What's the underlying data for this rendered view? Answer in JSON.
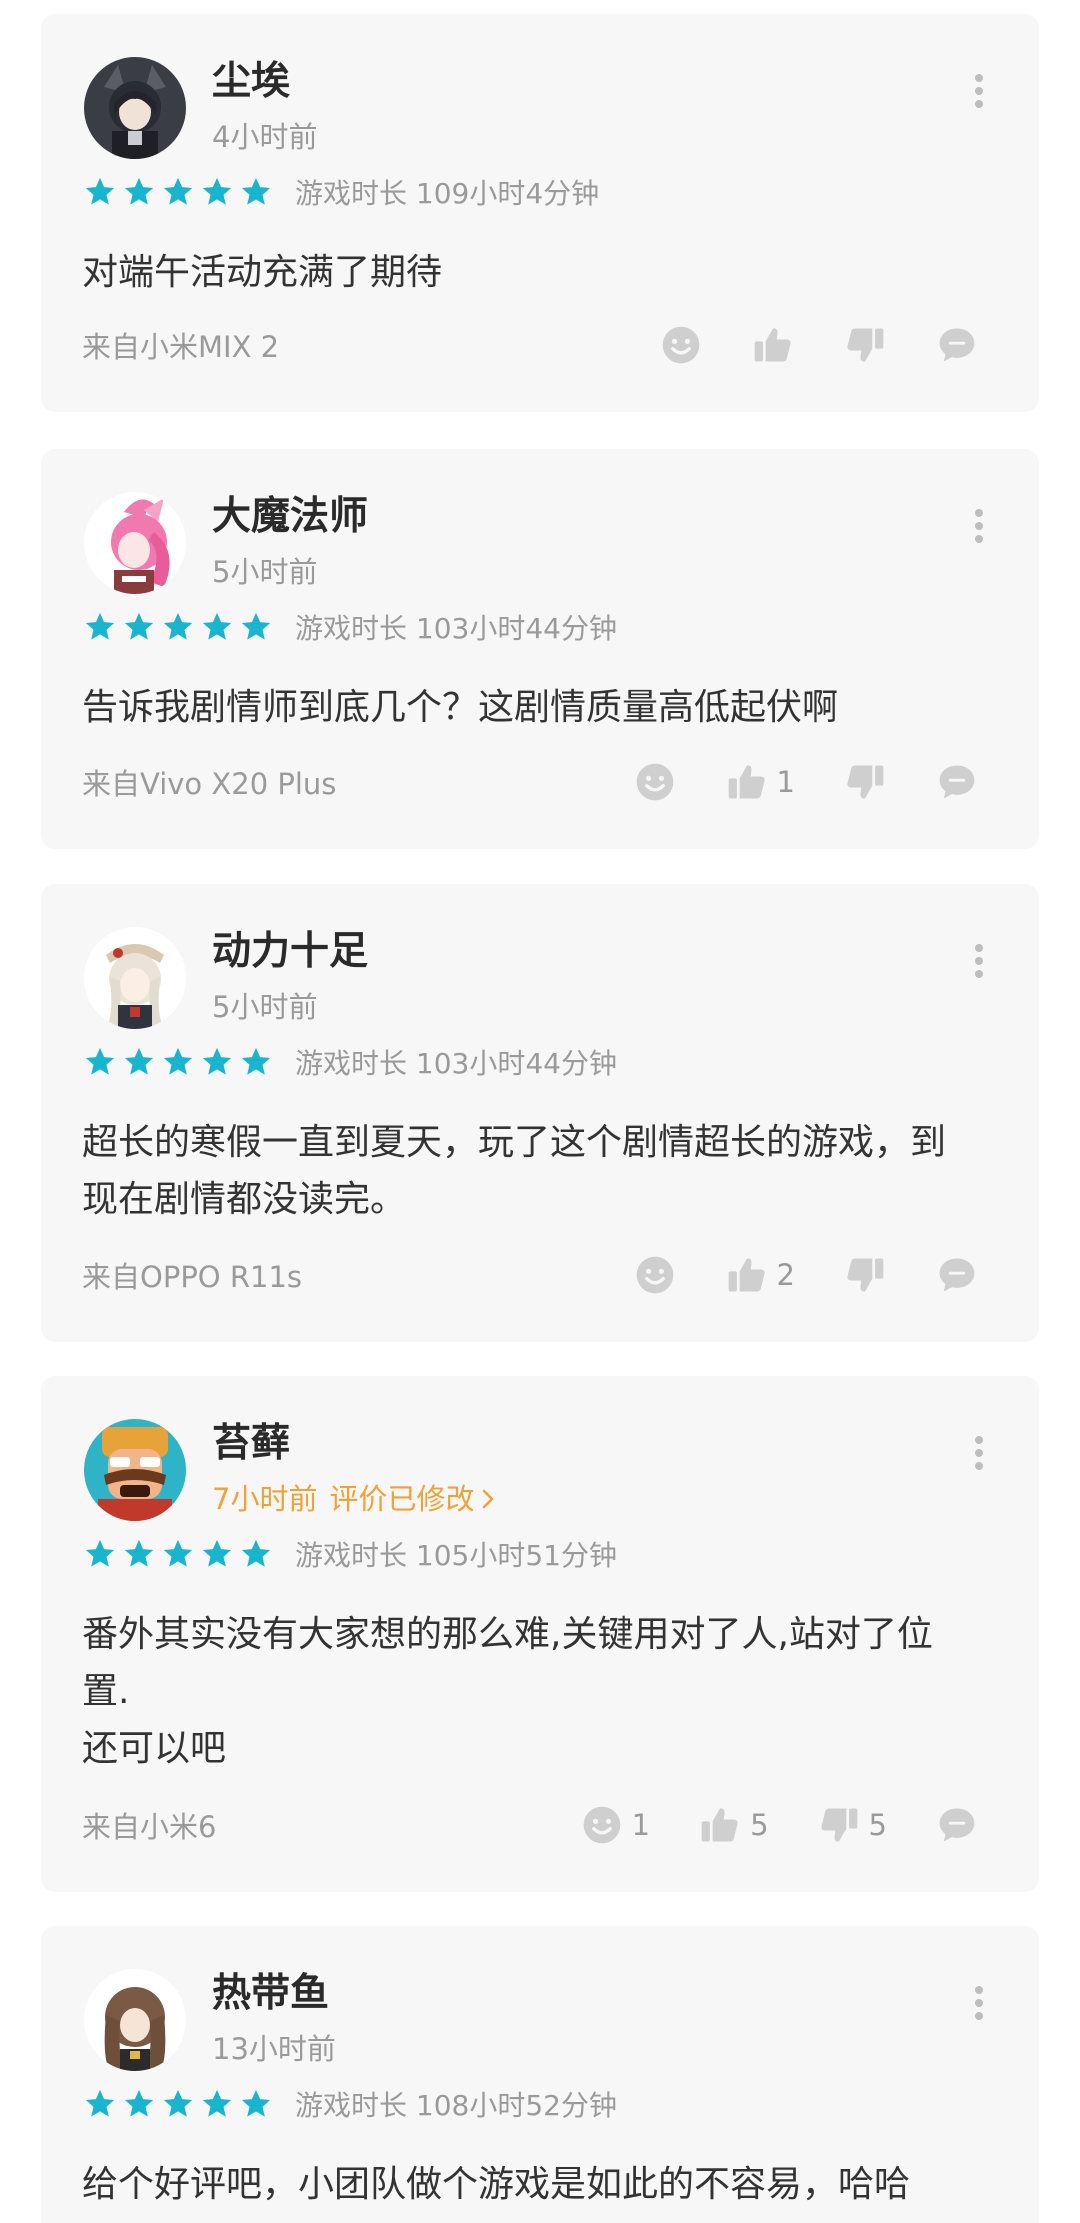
{
  "reviews": [
    {
      "username": "尘埃",
      "time": "4小时前",
      "edited": "",
      "playtime": "游戏时长 109小时4分钟",
      "text": "对端午活动充满了期待",
      "device": "来自小米MIX 2",
      "counts": {
        "funny": "",
        "like": "",
        "dislike": ""
      }
    },
    {
      "username": "大魔法师",
      "time": "5小时前",
      "edited": "",
      "playtime": "游戏时长 103小时44分钟",
      "text": "告诉我剧情师到底几个？这剧情质量高低起伏啊",
      "device": "来自Vivo X20 Plus",
      "counts": {
        "funny": "",
        "like": "1",
        "dislike": ""
      }
    },
    {
      "username": "动力十足",
      "time": "5小时前",
      "edited": "",
      "playtime": "游戏时长 103小时44分钟",
      "text": "超长的寒假一直到夏天，玩了这个剧情超长的游戏，到现在剧情都没读完。",
      "device": "来自OPPO R11s",
      "counts": {
        "funny": "",
        "like": "2",
        "dislike": ""
      }
    },
    {
      "username": "苔藓",
      "time": "7小时前",
      "edited": "评价已修改",
      "playtime": "游戏时长 105小时51分钟",
      "text": "番外其实没有大家想的那么难,关键用对了人,站对了位置.\n还可以吧",
      "device": "来自小米6",
      "counts": {
        "funny": "1",
        "like": "5",
        "dislike": "5"
      }
    },
    {
      "username": "热带鱼",
      "time": "13小时前",
      "edited": "",
      "playtime": "游戏时长 108小时52分钟",
      "text": "给个好评吧，小团队做个游戏是如此的不容易，哈哈",
      "device": "",
      "counts": {
        "funny": "",
        "like": "",
        "dislike": ""
      }
    }
  ],
  "colors": {
    "star": "#19b5cf",
    "icon": "#cfcfcf",
    "edited": "#f0a23a",
    "card_bg": "#f7f7f7"
  },
  "icons": {
    "star": "star-icon",
    "more": "more-vertical-icon",
    "funny": "smiley-face-icon",
    "like": "thumbs-up-icon",
    "dislike": "thumbs-down-icon",
    "reply": "comment-bubble-icon"
  }
}
